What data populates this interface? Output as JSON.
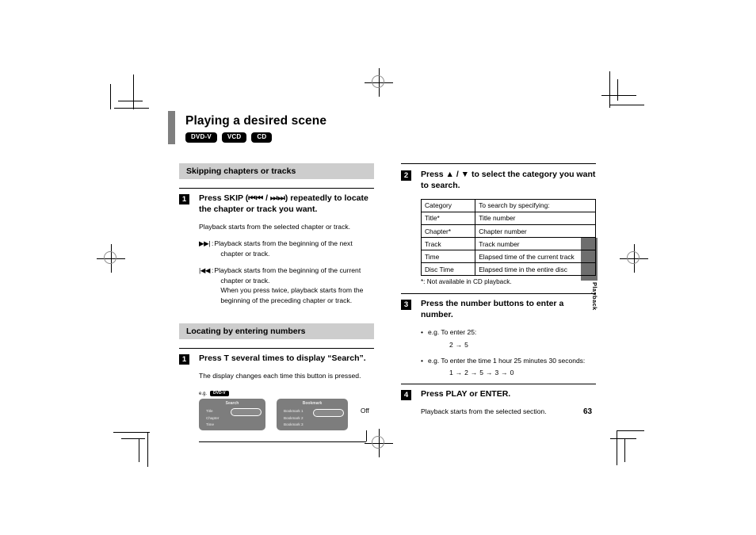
{
  "document": {
    "page_number": "63",
    "thumb_tab_label": "Playback",
    "title": "Playing a desired scene",
    "disc_badges": [
      "DVD-V",
      "VCD",
      "CD"
    ]
  },
  "left_column": {
    "section_1": {
      "heading": "Skipping chapters or tracks",
      "step": {
        "number": "1",
        "title": "Press SKIP (⏮⏮ / ⏭⏭) repeatedly to locate the chapter or track you want.",
        "body": "Playback starts from the selected chapter or track.",
        "definitions": [
          {
            "symbol": "▶▶|",
            "colon": ":",
            "line1": "Playback starts from the beginning of the next",
            "line2": "chapter or track.",
            "line3": ""
          },
          {
            "symbol": "|◀◀",
            "colon": ":",
            "line1": "Playback starts from the beginning of the current",
            "line2": "chapter or track.",
            "line3": "When you press twice, playback starts from the beginning of the preceding chapter or track."
          }
        ]
      }
    },
    "section_2": {
      "heading": "Locating by entering numbers",
      "step": {
        "number": "1",
        "title": "Press T several times to display “Search”.",
        "body": "The display changes each time this button is pressed."
      },
      "osd_example": {
        "eg_label": "e.g.",
        "eg_badge": "DVD-V",
        "panel_search": {
          "header": "Search",
          "items": [
            "Title",
            "Chapter",
            "Time"
          ]
        },
        "panel_bookmark": {
          "header": "Bookmark",
          "items": [
            "Bookmark 1",
            "Bookmark 2",
            "Bookmark 3"
          ]
        },
        "off_label": "Off"
      }
    }
  },
  "right_column": {
    "step_2": {
      "number": "2",
      "title": "Press ▲ / ▼ to select the category you want to search.",
      "table": {
        "headers": [
          "Category",
          "To search by specifying:"
        ],
        "rows": [
          [
            "Title*",
            "Title number"
          ],
          [
            "Chapter*",
            "Chapter number"
          ],
          [
            "Track",
            "Track number"
          ],
          [
            "Time",
            "Elapsed time of the current track"
          ],
          [
            "Disc Time",
            "Elapsed time in the entire disc"
          ]
        ],
        "note": "*: Not available in CD playback."
      }
    },
    "step_3": {
      "number": "3",
      "title": "Press the number buttons to enter a number.",
      "bullets": [
        {
          "dot": "•",
          "text": "e.g. To enter 25:"
        },
        {
          "dot": "•",
          "text": "e.g. To enter the time 1 hour 25 minutes 30 seconds:"
        }
      ],
      "sequence_1": "2 → 5",
      "sequence_2": "1 → 2 → 5 → 3 → 0"
    },
    "step_4": {
      "number": "4",
      "title": "Press PLAY or ENTER.",
      "body": "Playback starts from the selected section."
    }
  },
  "colors": {
    "title_accent": "#7f7f7f",
    "section_band": "#cdcdcd",
    "osd_panel": "#7d7d7d",
    "thumb_tab": "#6e6e6e"
  }
}
